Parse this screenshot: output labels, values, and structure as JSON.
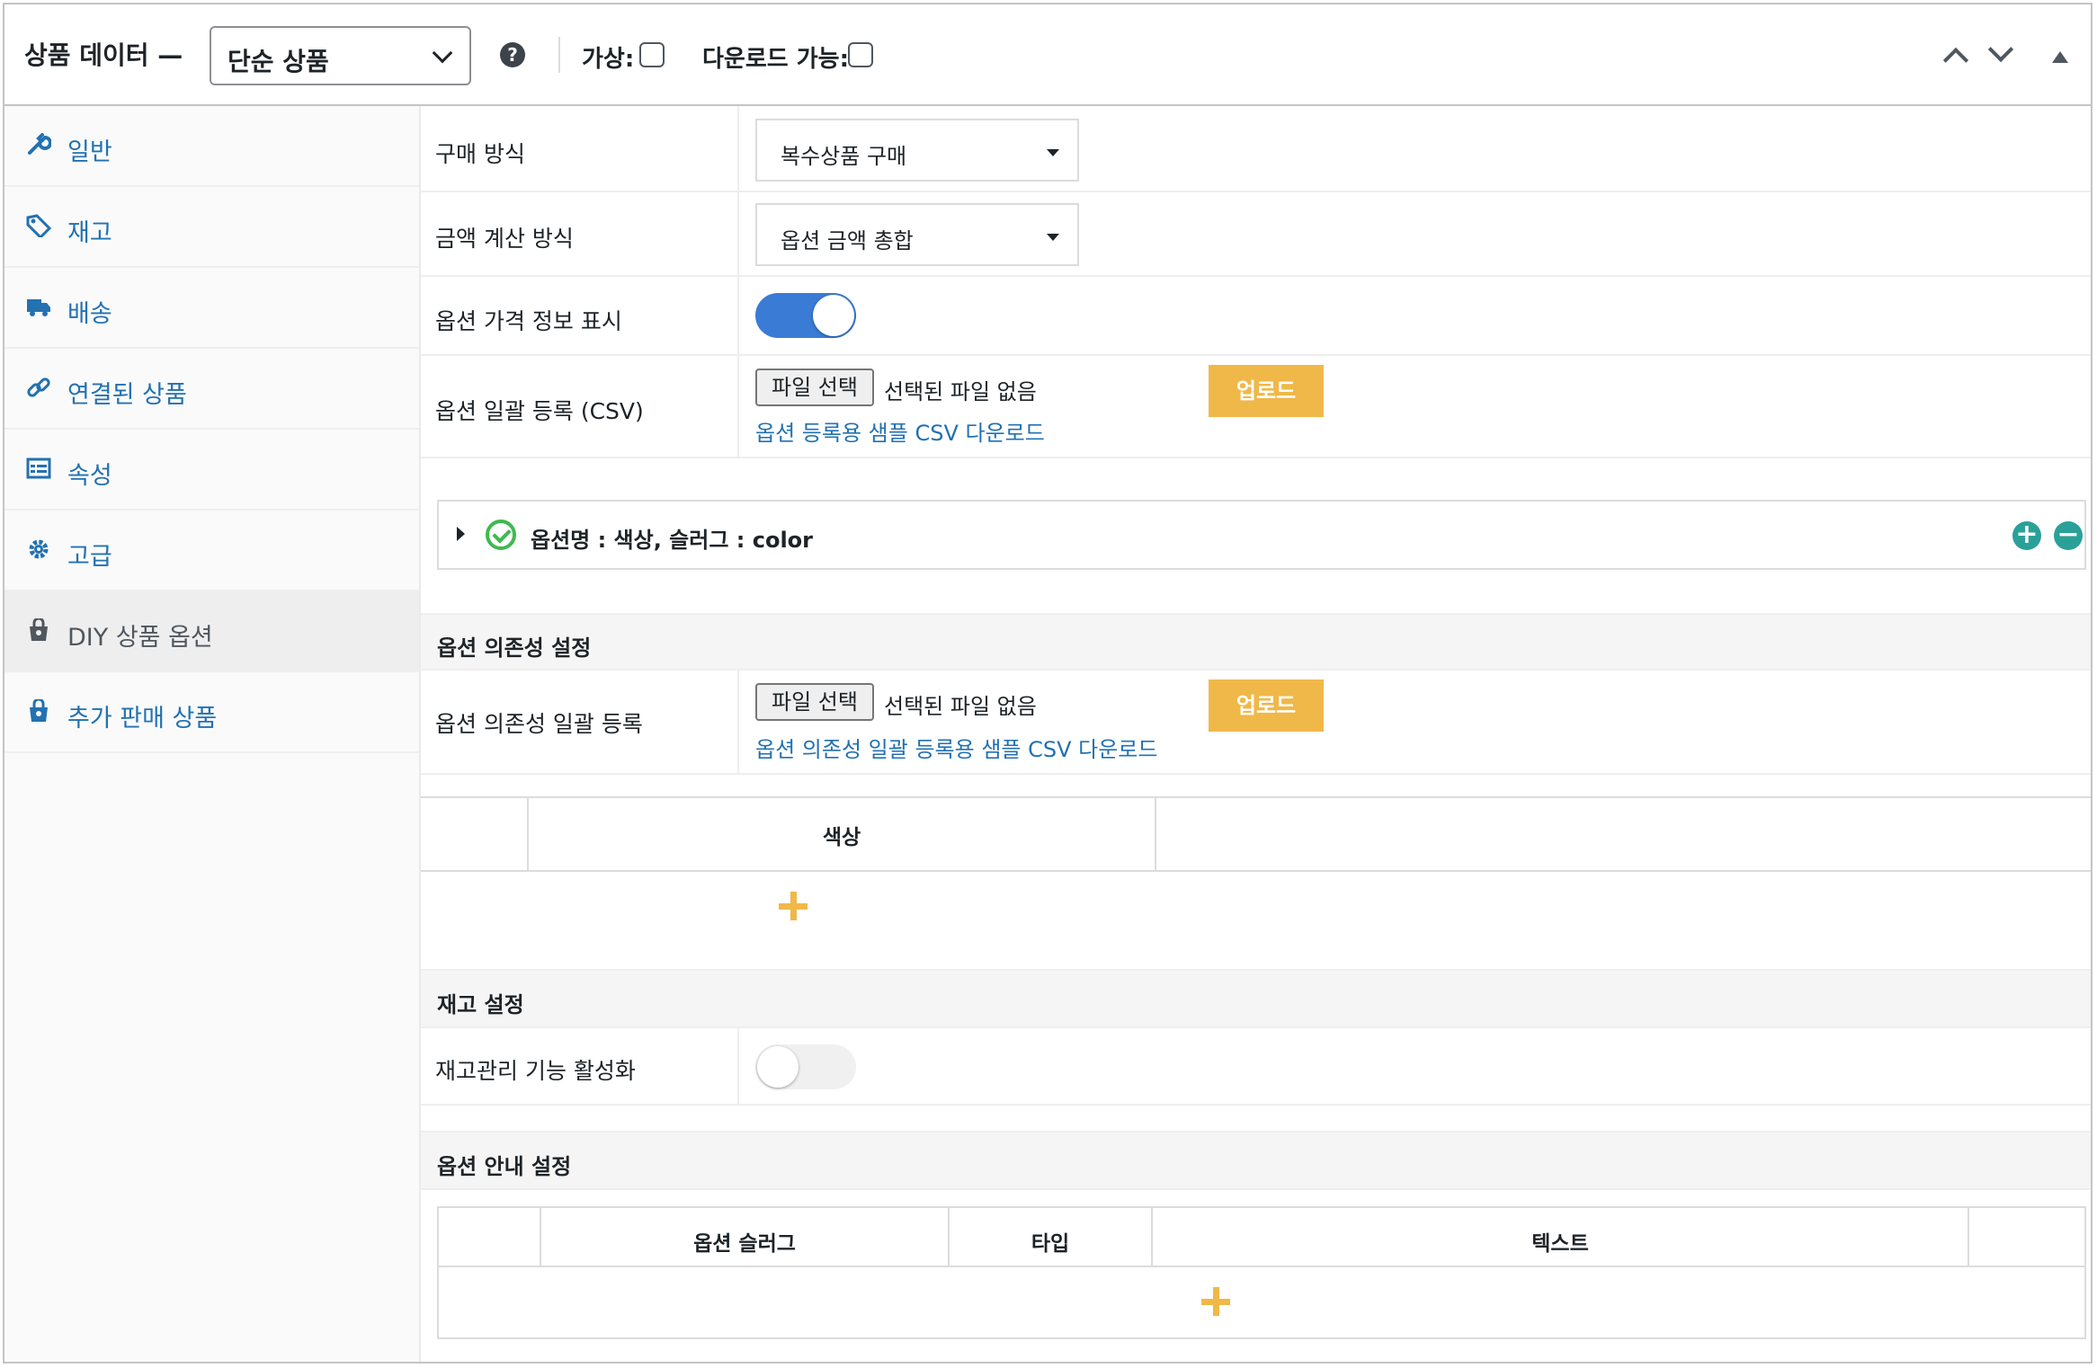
{
  "header": {
    "title": "상품 데이터 —",
    "product_type": "단순 상품",
    "virtual_label": "가상:",
    "downloadable_label": "다운로드 가능:"
  },
  "sidebar": {
    "items": [
      {
        "label": "일반",
        "icon": "wrench-icon"
      },
      {
        "label": "재고",
        "icon": "tag-icon"
      },
      {
        "label": "배송",
        "icon": "truck-icon"
      },
      {
        "label": "연결된 상품",
        "icon": "link-icon"
      },
      {
        "label": "속성",
        "icon": "list-table-icon"
      },
      {
        "label": "고급",
        "icon": "gear-icon"
      },
      {
        "label": "DIY 상품 옵션",
        "icon": "shop-bag-icon",
        "active": true
      },
      {
        "label": "추가 판매 상품",
        "icon": "shop-bag-icon"
      }
    ]
  },
  "main": {
    "purchase_method": {
      "label": "구매 방식",
      "value": "복수상품 구매"
    },
    "price_calc": {
      "label": "금액 계산 방식",
      "value": "옵션 금액 총합"
    },
    "show_price_info": {
      "label": "옵션 가격 정보 표시",
      "enabled": true
    },
    "bulk_csv": {
      "label": "옵션 일괄 등록 (CSV)",
      "file_button": "파일 선택",
      "no_file": "선택된 파일 없음",
      "upload": "업로드",
      "sample_link": "옵션 등록용 샘플 CSV 다운로드"
    },
    "option_item": {
      "text": "옵션명 : 색상, 슬러그 : color"
    },
    "dependency": {
      "title": "옵션 의존성 설정",
      "label": "옵션 의존성 일괄 등록",
      "file_button": "파일 선택",
      "no_file": "선택된 파일 없음",
      "upload": "업로드",
      "sample_link": "옵션 의존성 일괄 등록용 샘플 CSV 다운로드",
      "column": "색상"
    },
    "stock": {
      "title": "재고 설정",
      "label": "재고관리 기능 활성화",
      "enabled": false
    },
    "guide": {
      "title": "옵션 안내 설정",
      "columns": [
        "옵션 슬러그",
        "타입",
        "텍스트"
      ]
    }
  },
  "colors": {
    "accent": "#2271b1",
    "toggle_on": "#3a7bd5",
    "upload": "#f0b849",
    "check": "#3fb950",
    "circle": "#2aa198"
  }
}
